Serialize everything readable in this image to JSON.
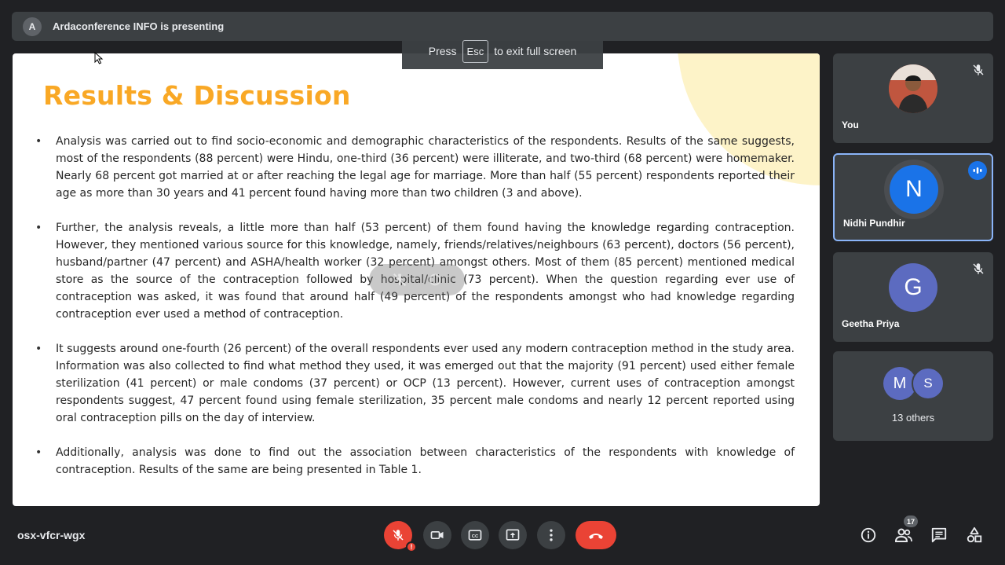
{
  "presenter": {
    "avatar_letter": "A",
    "text": "Ardaconference INFO is presenting"
  },
  "esc_banner": {
    "prefix": "Press",
    "key": "Esc",
    "suffix": "to exit full screen"
  },
  "slide": {
    "title": "Results & Discussion",
    "bullets": [
      "Analysis was carried out to find socio-economic and demographic characteristics of the respondents. Results of the same suggests, most of the respondents (88 percent) were Hindu, one-third (36 percent) were illiterate, and two-third (68 percent) were homemaker. Nearly 68 percent got married at or after reaching the legal age for marriage. More than half (55 percent) respondents reported their age as more than 30 years and 41 percent found having more than two children (3 and above).",
      "Further, the analysis reveals, a little more than half (53 percent) of them found having the knowledge regarding contraception. However, they mentioned various source for this knowledge, namely, friends/relatives/neighbours (63 percent), doctors (56 percent), husband/partner (47 percent) and ASHA/health worker (32 percent) amongst others. Most of them (85 percent) mentioned medical store as the source of the contraception followed by hospital/clinic (73 percent). When the question regarding ever use of contraception was asked, it was found that around half (49 percent) of the respondents amongst who had knowledge regarding contraception ever used a method of contraception.",
      "It suggests around one-fourth (26 percent) of the overall respondents ever used any modern contraception method in the study area. Information was also collected to find what method they used, it was emerged out that the majority (91 percent) used either female sterilization (41 percent) or male condoms (37 percent) or OCP (13 percent). However, current uses of contraception amongst respondents suggest, 47 percent found using female sterilization, 35 percent male condoms and nearly 12 percent reported using oral contraception pills on the day of interview.",
      "Additionally, analysis was done to find out the association between characteristics of the respondents with knowledge of contraception. Results of the same are being presented in Table 1."
    ]
  },
  "participants": {
    "you": {
      "name": "You"
    },
    "nidhi": {
      "name": "Nidhi Pundhir",
      "initial": "N",
      "color": "#1a73e8"
    },
    "geetha": {
      "name": "Geetha Priya",
      "initial": "G",
      "color": "#5c6bc0"
    },
    "others": {
      "label": "13 others",
      "initials": [
        "M",
        "S"
      ],
      "colors": [
        "#5c6bc0",
        "#5c6bc0"
      ]
    }
  },
  "bottom_bar": {
    "meeting_code": "osx-vfcr-wgx",
    "participant_count": "17"
  },
  "colors": {
    "end_call": "#ea4335",
    "accent": "#8ab4f8",
    "title": "#f9a825"
  }
}
